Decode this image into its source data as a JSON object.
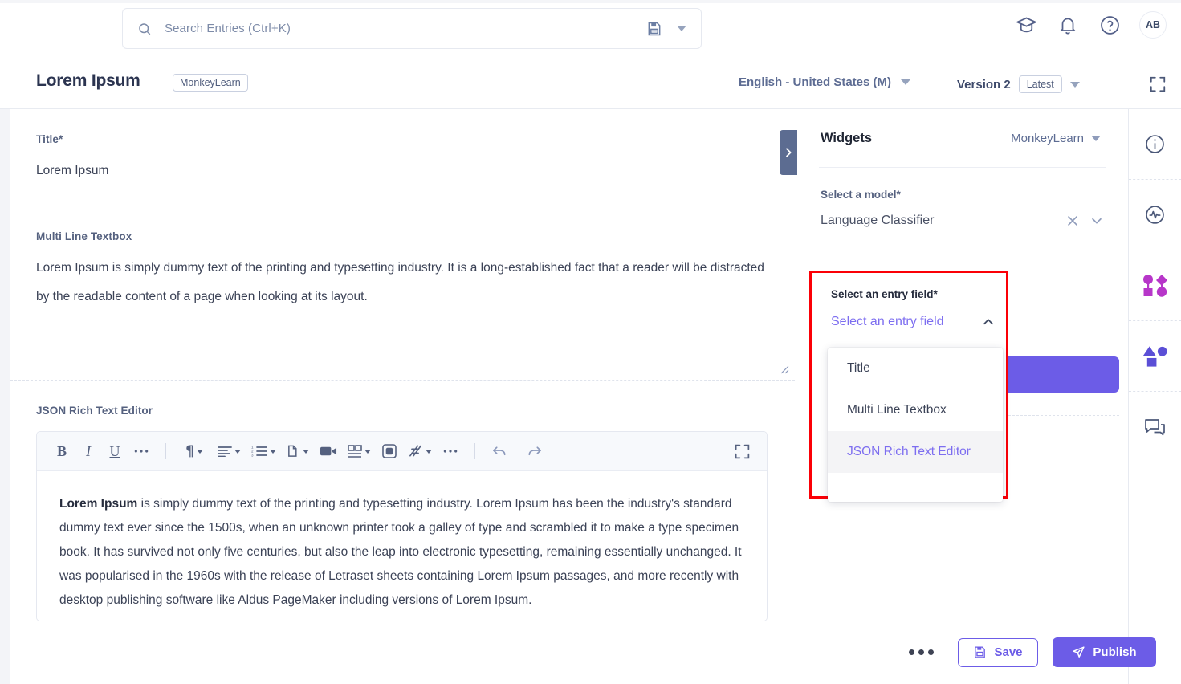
{
  "topbar": {
    "search": {
      "placeholder": "Search Entries (Ctrl+K)"
    },
    "icons": {
      "search": "search-icon",
      "saved_searches": "floppy-disk-icon",
      "dropdown": "caret-down-icon",
      "academy": "graduation-cap-icon",
      "notifications": "bell-icon",
      "help": "question-circle-icon"
    },
    "avatar_initials": "AB"
  },
  "title_row": {
    "title": "Lorem Ipsum",
    "tag": "MonkeyLearn",
    "language": "English - United States (M)",
    "version": "Version 2",
    "version_badge": "Latest",
    "expand_icon": "fullscreen-icon"
  },
  "main": {
    "fields": [
      {
        "label": "Title*",
        "value": "Lorem Ipsum"
      },
      {
        "label": "Multi Line Textbox",
        "value": "Lorem Ipsum is simply dummy text of the printing and typesetting industry. It is a long-established fact that a reader will be distracted by the readable content of a page when looking at its layout."
      },
      {
        "label": "JSON Rich Text Editor"
      }
    ],
    "editor": {
      "toolbar": [
        {
          "name": "bold",
          "glyph": "B"
        },
        {
          "name": "italic",
          "glyph": "I"
        },
        {
          "name": "underline",
          "glyph": "U"
        },
        {
          "name": "more-text-format",
          "glyph": "•••"
        },
        {
          "name": "paragraph-format",
          "glyph": "¶"
        },
        {
          "name": "align",
          "glyph": "align"
        },
        {
          "name": "ordered-list",
          "glyph": "list"
        },
        {
          "name": "copy-paste",
          "glyph": "copy"
        },
        {
          "name": "insert-video",
          "glyph": "video"
        },
        {
          "name": "insert-table",
          "glyph": "table"
        },
        {
          "name": "insert-embed",
          "glyph": "embed"
        },
        {
          "name": "clear-formatting",
          "glyph": "eraser"
        },
        {
          "name": "more-misc",
          "glyph": "•••"
        },
        {
          "name": "undo",
          "glyph": "undo"
        },
        {
          "name": "redo",
          "glyph": "redo"
        },
        {
          "name": "fullscreen",
          "glyph": "fullscreen"
        }
      ],
      "content_bold_lead": "Lorem Ipsum",
      "content_rest": " is simply dummy text of the printing and typesetting industry. Lorem Ipsum has been the industry's standard dummy text ever since the 1500s, when an unknown printer took a galley of type and scrambled it to make a type specimen book. It has survived not only five centuries, but also the leap into electronic typesetting, remaining essentially unchanged. It was popularised in the 1960s with the release of Letraset sheets containing Lorem Ipsum passages, and more recently with desktop publishing software like Aldus PageMaker including versions of Lorem Ipsum."
    }
  },
  "right_panel": {
    "heading": "Widgets",
    "source": "MonkeyLearn",
    "model_field": {
      "label": "Select a model*",
      "value": "Language Classifier",
      "clear_icon": "close-icon",
      "expand_icon": "chevron-down-icon"
    },
    "entry_field": {
      "label": "Select an entry field*",
      "placeholder": "Select an entry field",
      "collapse_icon": "chevron-up-icon",
      "options": [
        {
          "label": "Title",
          "selected": false
        },
        {
          "label": "Multi Line Textbox",
          "selected": false
        },
        {
          "label": "JSON Rich Text Editor",
          "selected": true
        }
      ]
    },
    "collapse_tab_icon": "chevron-right-icon"
  },
  "bottom_actions": {
    "more_label": "more-options",
    "save_label": "Save",
    "publish_label": "Publish"
  },
  "right_rail": [
    {
      "name": "info",
      "icon": "info-circle-icon"
    },
    {
      "name": "activity",
      "icon": "pulse-circle-icon"
    },
    {
      "name": "widgets",
      "icon": "shapes-connected-icon"
    },
    {
      "name": "components",
      "icon": "shapes-icon"
    },
    {
      "name": "comments",
      "icon": "chat-bubbles-icon"
    }
  ],
  "colors": {
    "accent_purple": "#6c5ce7",
    "highlight_red": "#fb0007",
    "text_dark": "#2b3450",
    "text_muted": "#55617f"
  }
}
